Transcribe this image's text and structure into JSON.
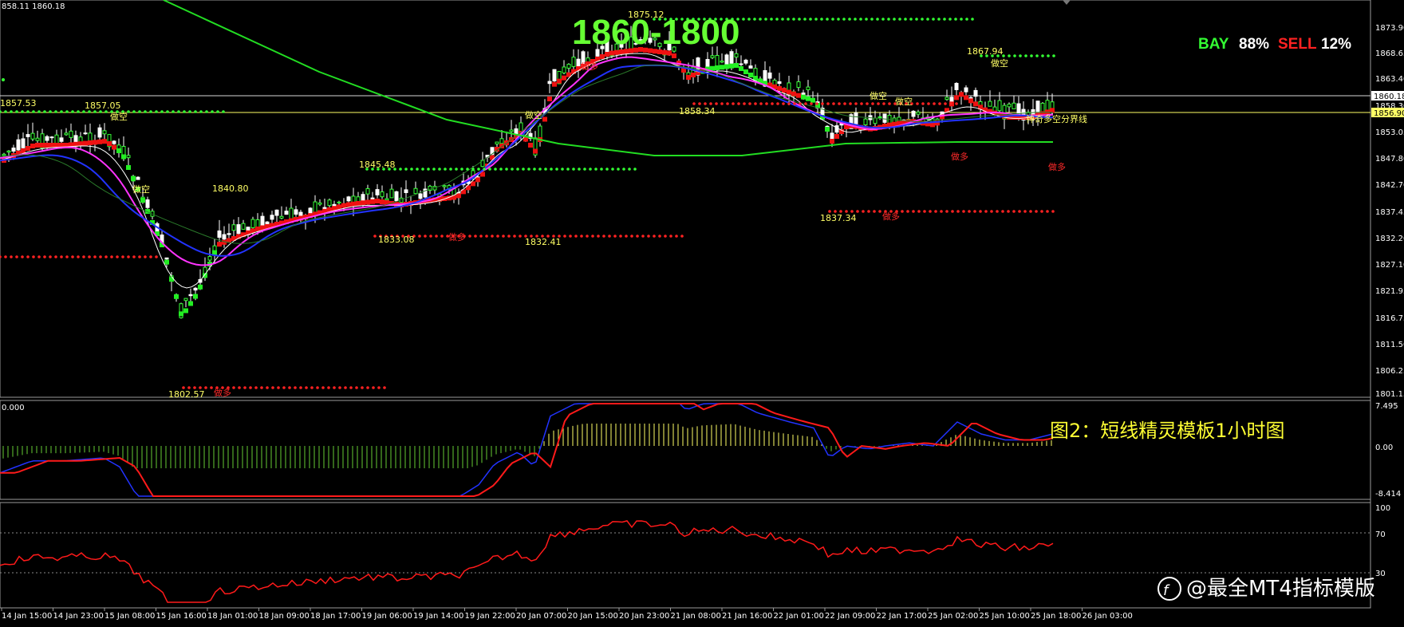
{
  "header": {
    "ohlc_text": "858.11 1860.18"
  },
  "zone_label": "1860-1800",
  "sentiment": {
    "buy_label": "BAY",
    "buy_value": "88%",
    "sell_label": "SELL",
    "sell_value": "12%",
    "buy_color": "#33ff33",
    "sell_color": "#ff2222"
  },
  "caption": "图2：短线精灵模板1小时图",
  "watermark": "@最全MT4指标模版",
  "price_axis": {
    "ticks": [
      "1873.90",
      "1868.65",
      "1863.40",
      "1858.30",
      "1853.05",
      "1847.80",
      "1842.70",
      "1837.45",
      "1832.20",
      "1827.10",
      "1821.95",
      "1816.75",
      "1811.50",
      "1806.25",
      "1801.15"
    ],
    "current": "1860.18",
    "line2": "1856.90"
  },
  "macd_axis": {
    "ticks": [
      "7.495",
      "0.00",
      "-8.414"
    ],
    "top_left": "0.000"
  },
  "rsi_axis": {
    "ticks": [
      "100",
      "70",
      "30"
    ]
  },
  "time_axis": [
    "14 Jan 15:00",
    "14 Jan 23:00",
    "15 Jan 08:00",
    "15 Jan 16:00",
    "18 Jan 01:00",
    "18 Jan 09:00",
    "18 Jan 17:00",
    "19 Jan 06:00",
    "19 Jan 14:00",
    "19 Jan 22:00",
    "20 Jan 07:00",
    "20 Jan 15:00",
    "20 Jan 23:00",
    "21 Jan 08:00",
    "21 Jan 16:00",
    "22 Jan 01:00",
    "22 Jan 09:00",
    "22 Jan 17:00",
    "25 Jan 02:00",
    "25 Jan 10:00",
    "25 Jan 18:00",
    "26 Jan 03:00"
  ],
  "chart_data": {
    "type": "line",
    "title": "",
    "price_levels": [
      {
        "label": "1857.53"
      },
      {
        "label": "1857.05"
      },
      {
        "label": "1840.80"
      },
      {
        "label": "1845.48"
      },
      {
        "label": "1833.08"
      },
      {
        "label": "1832.41"
      },
      {
        "label": "1875.12"
      },
      {
        "label": "1858.34"
      },
      {
        "label": "1837.34"
      },
      {
        "label": "1867.94"
      },
      {
        "label": "1802.57"
      }
    ],
    "signal_labels": [
      "做空",
      "做多",
      "做空",
      "做多",
      "做空",
      "做多",
      "做空",
      "做多",
      "做空",
      "做多",
      "做空",
      "做多"
    ],
    "divider_label": "神奇多空分界线",
    "macd_range": [
      -8.414,
      7.495
    ],
    "rsi_levels": [
      70,
      30
    ],
    "ylim": [
      1801.15,
      1873.9
    ]
  }
}
